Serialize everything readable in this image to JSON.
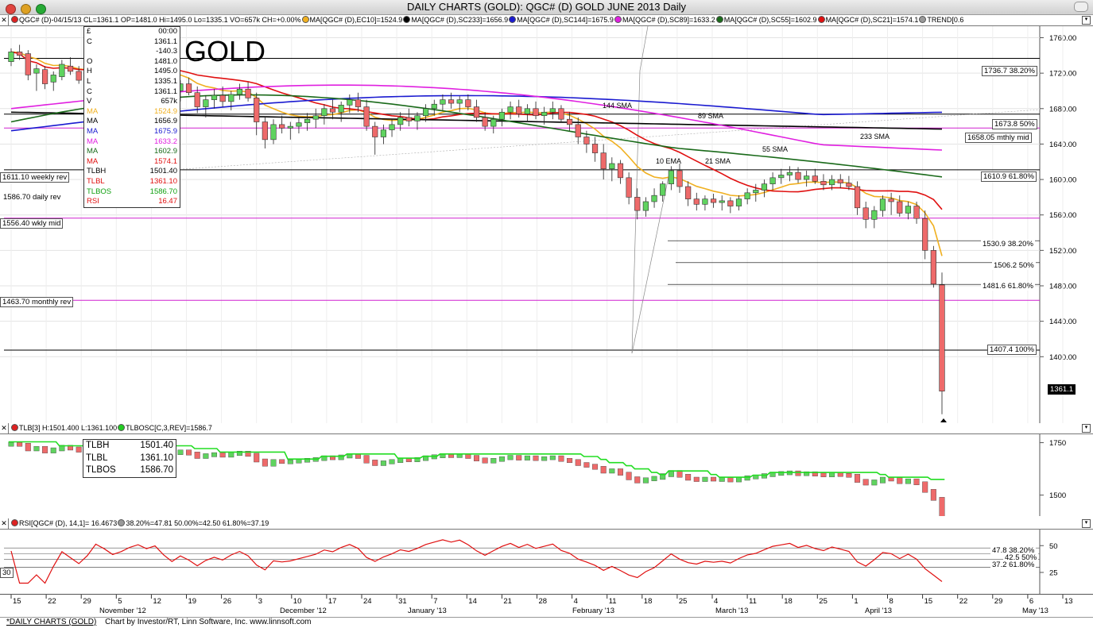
{
  "window": {
    "title": "DAILY CHARTS (GOLD): QGC# (D) GOLD JUNE 2013 Daily"
  },
  "price_header": {
    "symbol": "QGC# (D)",
    "quote": "-04/15/13 CL=1361.1 OP=1481.0 Hi=1495.0 Lo=1335.1 VO=657k CH=+0.00%",
    "studies": [
      {
        "label": "MA[QGC# (D),EC10]=1524.9",
        "color": "#f0b020"
      },
      {
        "label": "MA[QGC# (D),SC233]=1656.9",
        "color": "#000000"
      },
      {
        "label": "MA[QGC# (D),SC144]=1675.9",
        "color": "#1a1ad0"
      },
      {
        "label": "MA[QGC# (D),SC89]=1633.2",
        "color": "#e020e0"
      },
      {
        "label": "MA[QGC# (D),SC55]=1602.9",
        "color": "#1a6a1a"
      },
      {
        "label": "MA[QGC# (D),SC21]=1574.1",
        "color": "#e01010"
      },
      {
        "label": "TREND[0.6",
        "color": "#999999"
      }
    ]
  },
  "chart_title": "GOLD",
  "data_box": {
    "header": [
      "£",
      "00:00"
    ],
    "rows": [
      {
        "k": "C",
        "v": "1361.1",
        "c": "#000000"
      },
      {
        "k": "",
        "v": "-140.3",
        "c": "#000000"
      },
      {
        "k": "O",
        "v": "1481.0",
        "c": "#000000"
      },
      {
        "k": "H",
        "v": "1495.0",
        "c": "#000000"
      },
      {
        "k": "L",
        "v": "1335.1",
        "c": "#000000"
      },
      {
        "k": "C",
        "v": "1361.1",
        "c": "#000000"
      },
      {
        "k": "V",
        "v": "657k",
        "c": "#000000"
      },
      {
        "k": "MA",
        "v": "1524.9",
        "c": "#f0b020"
      },
      {
        "k": "MA",
        "v": "1656.9",
        "c": "#000000"
      },
      {
        "k": "MA",
        "v": "1675.9",
        "c": "#1a1ad0"
      },
      {
        "k": "MA",
        "v": "1633.2",
        "c": "#e020e0"
      },
      {
        "k": "MA",
        "v": "1602.9",
        "c": "#1a6a1a"
      },
      {
        "k": "MA",
        "v": "1574.1",
        "c": "#e01010"
      },
      {
        "k": "TLBH",
        "v": "1501.40",
        "c": "#000000"
      },
      {
        "k": "TLBL",
        "v": "1361.10",
        "c": "#e01010"
      },
      {
        "k": "TLBOS",
        "v": "1586.70",
        "c": "#10a010"
      },
      {
        "k": "RSI",
        "v": "16.47",
        "c": "#e01010"
      }
    ]
  },
  "left_labels": {
    "weekly_rev": "1611.10 weekly rev",
    "daily_rev": "1586.70 daily rev",
    "wkly_mid": "1556.40 wkly mid",
    "monthly_rev": "1463.70 monthly rev"
  },
  "right_labels": {
    "fib_top": "1736.7 38.20%",
    "fib_50_upper": "1673.8 50%",
    "mthly_mid": "1658.05 mthly mid",
    "fib_618_upper": "1610.9 61.80%",
    "fib_382": "1530.9 38.20%",
    "fib_50": "1506.2 50%",
    "fib_618": "1481.6 61.80%",
    "fib_100": "1407.4 100%",
    "last_price": "1361.1"
  },
  "ma_labels": {
    "sma144": "144 SMA",
    "sma89": "89 SMA",
    "sma233": "233 SMA",
    "sma55": "55 SMA",
    "ema10": "10 EMA",
    "sma21": "21 SMA"
  },
  "tlb_header": {
    "left": "TLB[3] H:1501.400 L:1361.100",
    "right": "TLBOSC[C,3,REV]=1586.7"
  },
  "tlb_box": {
    "rows": [
      {
        "k": "TLBH",
        "v": "1501.40"
      },
      {
        "k": "TLBL",
        "v": "1361.10"
      },
      {
        "k": "TLBOS",
        "v": "1586.70"
      }
    ]
  },
  "rsi_header": {
    "left": "RSI[QGC# (D), 14,1]= 16.4673",
    "right": "38.20%=47.81 50.00%=42.50 61.80%=37.19"
  },
  "rsi_labels": {
    "r382": "47.8 38.20%",
    "r50": "42.5 50%",
    "r618": "37.2 61.80%",
    "thirty": "30"
  },
  "x_axis": {
    "days": [
      "15",
      "22",
      "29",
      "5",
      "12",
      "19",
      "26",
      "3",
      "10",
      "17",
      "24",
      "31",
      "7",
      "14",
      "21",
      "28",
      "4",
      "11",
      "18",
      "25",
      "4",
      "11",
      "18",
      "25",
      "1",
      "8",
      "15",
      "22",
      "29",
      "6",
      "13"
    ],
    "months": [
      "November '12",
      "December '12",
      "January '13",
      "February '13",
      "March '13",
      "April '13",
      "May '13"
    ]
  },
  "footer": {
    "link": "*DAILY CHARTS (GOLD)",
    "credit": "Chart by Investor/RT, Linn Software, Inc. www.linnsoft.com"
  },
  "chart_data": {
    "type": "candlestick",
    "title": "GOLD",
    "symbol": "QGC# (D) GOLD JUNE 2013 Daily",
    "price_axis": {
      "ticks": [
        1760,
        1720,
        1680,
        1640,
        1600,
        1560,
        1520,
        1480,
        1440,
        1400
      ],
      "ylim": [
        1325,
        1773
      ]
    },
    "last_bar": {
      "date": "04/15/13",
      "open": 1481.0,
      "high": 1495.0,
      "low": 1335.1,
      "close": 1361.1,
      "volume": "657k",
      "change": -140.3
    },
    "ohlc": [
      [
        1733,
        1748,
        1728,
        1744
      ],
      [
        1744,
        1752,
        1735,
        1740
      ],
      [
        1742,
        1746,
        1712,
        1718
      ],
      [
        1720,
        1730,
        1700,
        1725
      ],
      [
        1724,
        1728,
        1702,
        1708
      ],
      [
        1710,
        1722,
        1700,
        1718
      ],
      [
        1716,
        1735,
        1712,
        1730
      ],
      [
        1728,
        1738,
        1718,
        1722
      ],
      [
        1722,
        1728,
        1708,
        1712
      ],
      [
        1712,
        1725,
        1705,
        1720
      ],
      [
        1720,
        1740,
        1715,
        1735
      ],
      [
        1735,
        1742,
        1722,
        1728
      ],
      [
        1728,
        1735,
        1712,
        1718
      ],
      [
        1718,
        1726,
        1705,
        1722
      ],
      [
        1722,
        1732,
        1715,
        1728
      ],
      [
        1728,
        1738,
        1720,
        1732
      ],
      [
        1732,
        1740,
        1722,
        1726
      ],
      [
        1726,
        1735,
        1718,
        1730
      ],
      [
        1730,
        1736,
        1710,
        1715
      ],
      [
        1715,
        1722,
        1695,
        1700
      ],
      [
        1700,
        1712,
        1688,
        1708
      ],
      [
        1708,
        1715,
        1695,
        1698
      ],
      [
        1698,
        1705,
        1675,
        1682
      ],
      [
        1682,
        1695,
        1670,
        1690
      ],
      [
        1690,
        1702,
        1680,
        1695
      ],
      [
        1695,
        1705,
        1682,
        1688
      ],
      [
        1688,
        1700,
        1678,
        1696
      ],
      [
        1696,
        1708,
        1690,
        1702
      ],
      [
        1702,
        1710,
        1688,
        1692
      ],
      [
        1692,
        1698,
        1650,
        1665
      ],
      [
        1665,
        1670,
        1635,
        1645
      ],
      [
        1645,
        1668,
        1640,
        1662
      ],
      [
        1662,
        1672,
        1652,
        1658
      ],
      [
        1658,
        1665,
        1645,
        1660
      ],
      [
        1660,
        1670,
        1652,
        1664
      ],
      [
        1664,
        1675,
        1655,
        1668
      ],
      [
        1668,
        1680,
        1658,
        1672
      ],
      [
        1672,
        1685,
        1662,
        1680
      ],
      [
        1680,
        1690,
        1668,
        1676
      ],
      [
        1676,
        1688,
        1665,
        1684
      ],
      [
        1684,
        1696,
        1675,
        1690
      ],
      [
        1690,
        1698,
        1676,
        1682
      ],
      [
        1682,
        1690,
        1655,
        1660
      ],
      [
        1660,
        1665,
        1628,
        1648
      ],
      [
        1648,
        1662,
        1640,
        1656
      ],
      [
        1656,
        1668,
        1648,
        1662
      ],
      [
        1662,
        1676,
        1655,
        1670
      ],
      [
        1670,
        1680,
        1660,
        1666
      ],
      [
        1666,
        1676,
        1656,
        1672
      ],
      [
        1672,
        1685,
        1665,
        1680
      ],
      [
        1680,
        1690,
        1672,
        1685
      ],
      [
        1685,
        1696,
        1678,
        1690
      ],
      [
        1690,
        1698,
        1680,
        1686
      ],
      [
        1686,
        1694,
        1676,
        1690
      ],
      [
        1690,
        1696,
        1678,
        1682
      ],
      [
        1682,
        1690,
        1665,
        1670
      ],
      [
        1670,
        1676,
        1655,
        1660
      ],
      [
        1660,
        1672,
        1652,
        1668
      ],
      [
        1668,
        1680,
        1660,
        1676
      ],
      [
        1676,
        1688,
        1668,
        1682
      ],
      [
        1682,
        1690,
        1670,
        1674
      ],
      [
        1674,
        1685,
        1665,
        1680
      ],
      [
        1680,
        1688,
        1668,
        1672
      ],
      [
        1672,
        1682,
        1662,
        1676
      ],
      [
        1676,
        1688,
        1668,
        1680
      ],
      [
        1680,
        1684,
        1664,
        1668
      ],
      [
        1668,
        1676,
        1655,
        1662
      ],
      [
        1662,
        1670,
        1640,
        1648
      ],
      [
        1648,
        1655,
        1630,
        1640
      ],
      [
        1640,
        1648,
        1620,
        1630
      ],
      [
        1630,
        1640,
        1600,
        1612
      ],
      [
        1612,
        1625,
        1598,
        1618
      ],
      [
        1618,
        1622,
        1595,
        1602
      ],
      [
        1602,
        1608,
        1572,
        1580
      ],
      [
        1580,
        1590,
        1555,
        1565
      ],
      [
        1565,
        1580,
        1558,
        1575
      ],
      [
        1575,
        1590,
        1568,
        1582
      ],
      [
        1582,
        1598,
        1575,
        1595
      ],
      [
        1595,
        1615,
        1588,
        1610
      ],
      [
        1610,
        1618,
        1585,
        1592
      ],
      [
        1592,
        1598,
        1570,
        1578
      ],
      [
        1578,
        1585,
        1565,
        1572
      ],
      [
        1572,
        1582,
        1565,
        1578
      ],
      [
        1578,
        1584,
        1568,
        1574
      ],
      [
        1574,
        1582,
        1565,
        1576
      ],
      [
        1576,
        1580,
        1562,
        1570
      ],
      [
        1570,
        1582,
        1565,
        1578
      ],
      [
        1578,
        1590,
        1572,
        1585
      ],
      [
        1585,
        1595,
        1575,
        1588
      ],
      [
        1588,
        1600,
        1580,
        1595
      ],
      [
        1595,
        1608,
        1588,
        1602
      ],
      [
        1602,
        1612,
        1595,
        1605
      ],
      [
        1605,
        1615,
        1598,
        1608
      ],
      [
        1608,
        1614,
        1596,
        1600
      ],
      [
        1600,
        1610,
        1592,
        1604
      ],
      [
        1604,
        1612,
        1595,
        1598
      ],
      [
        1598,
        1606,
        1588,
        1594
      ],
      [
        1594,
        1605,
        1588,
        1600
      ],
      [
        1600,
        1606,
        1590,
        1596
      ],
      [
        1596,
        1604,
        1588,
        1592
      ],
      [
        1592,
        1598,
        1560,
        1568
      ],
      [
        1568,
        1575,
        1545,
        1555
      ],
      [
        1555,
        1570,
        1545,
        1565
      ],
      [
        1565,
        1582,
        1558,
        1578
      ],
      [
        1578,
        1585,
        1560,
        1575
      ],
      [
        1575,
        1582,
        1558,
        1562
      ],
      [
        1562,
        1575,
        1555,
        1570
      ],
      [
        1570,
        1575,
        1550,
        1556
      ],
      [
        1556,
        1565,
        1510,
        1520
      ],
      [
        1520,
        1525,
        1478,
        1482
      ],
      [
        1481,
        1495,
        1335.1,
        1361.1
      ]
    ],
    "moving_averages": [
      {
        "name": "EC10",
        "value": 1524.9,
        "color": "#f0b020"
      },
      {
        "name": "SC233",
        "value": 1656.9,
        "color": "#000000"
      },
      {
        "name": "SC144",
        "value": 1675.9,
        "color": "#1a1ad0"
      },
      {
        "name": "SC89",
        "value": 1633.2,
        "color": "#e020e0"
      },
      {
        "name": "SC55",
        "value": 1602.9,
        "color": "#1a6a1a"
      },
      {
        "name": "SC21",
        "value": 1574.1,
        "color": "#e01010"
      }
    ],
    "horizontal_levels": [
      {
        "price": 1736.7,
        "label": "1736.7 38.20%",
        "color": "#000000"
      },
      {
        "price": 1673.8,
        "label": "1673.8 50%",
        "color": "#000000"
      },
      {
        "price": 1658.05,
        "label": "1658.05 mthly mid",
        "color": "#d020d0"
      },
      {
        "price": 1611.1,
        "label": "1611.10 weekly rev",
        "color": "#d020d0"
      },
      {
        "price": 1610.9,
        "label": "1610.9 61.80%",
        "color": "#000000"
      },
      {
        "price": 1586.7,
        "label": "1586.70 daily rev",
        "color": "#000000"
      },
      {
        "price": 1556.4,
        "label": "1556.40 wkly mid",
        "color": "#d020d0"
      },
      {
        "price": 1530.9,
        "label": "1530.9 38.20%",
        "color": "#000000"
      },
      {
        "price": 1506.2,
        "label": "1506.2 50%",
        "color": "#000000"
      },
      {
        "price": 1481.6,
        "label": "1481.6 61.80%",
        "color": "#000000"
      },
      {
        "price": 1463.7,
        "label": "1463.70 monthly rev",
        "color": "#d020d0"
      },
      {
        "price": 1407.4,
        "label": "1407.4 100%",
        "color": "#000000"
      }
    ],
    "tlb": {
      "high": 1501.4,
      "low": 1361.1,
      "osc": 1586.7,
      "axis_ticks": [
        1750,
        1500
      ]
    },
    "rsi": {
      "value": 16.4673,
      "levels": [
        47.81,
        42.5,
        37.19,
        30
      ],
      "axis_ticks": [
        50,
        25
      ]
    }
  }
}
